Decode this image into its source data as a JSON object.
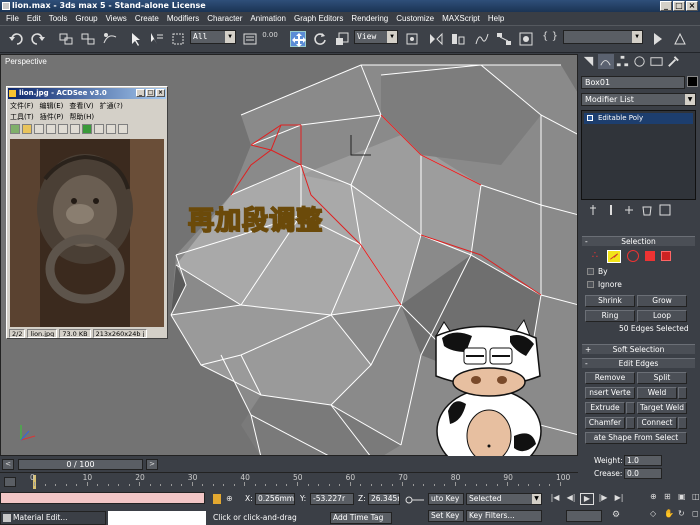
{
  "window": {
    "title": "lion.max - 3ds max 5 - Stand-alone License",
    "min": "_",
    "max": "□",
    "close": "×"
  },
  "menu": [
    "File",
    "Edit",
    "Tools",
    "Group",
    "Views",
    "Create",
    "Modifiers",
    "Character",
    "Animation",
    "Graph Editors",
    "Rendering",
    "Customize",
    "MAXScript",
    "Help"
  ],
  "toolbar": {
    "selection_filter": "All",
    "coord_system": "View",
    "angle_snap_label": "0.00"
  },
  "viewport": {
    "label": "Perspective",
    "caption": "再加段调整"
  },
  "acdsee": {
    "title": "lion.jpg - ACDSee v3.0",
    "menu_row1": [
      "文件(F)",
      "编辑(E)",
      "查看(V)",
      "扩通(?)"
    ],
    "menu_row2": [
      "工具(T)",
      "插件(P)",
      "帮助(H)"
    ],
    "status": {
      "index": "2/2",
      "file": "lion.jpg",
      "size": "73.0 KB",
      "dims": "213x260x24b j"
    }
  },
  "command_panel": {
    "object_name": "Box01",
    "modifier_list": "Modifier List",
    "stack": [
      "Editable Poly"
    ],
    "selection": {
      "title": "Selection",
      "by_label": "By",
      "ignore_label": "Ignore",
      "shrink": "Shrink",
      "grow": "Grow",
      "ring": "Ring",
      "loop": "Loop",
      "status": "50 Edges Selected"
    },
    "soft_selection": {
      "title": "Soft Selection",
      "sign": "+"
    },
    "edit_edges": {
      "title": "Edit Edges",
      "remove": "Remove",
      "split": "Split",
      "insert_vertex": "nsert Verte",
      "weld": "Weld",
      "extrude": "Extrude",
      "target_weld": "Target Weld",
      "chamfer": "Chamfer",
      "connect": "Connect",
      "create_shape": "ate Shape From Select",
      "weight_label": "Weight:",
      "weight_value": "1.0",
      "crease_label": "Crease:",
      "crease_value": "0.0"
    }
  },
  "timeline": {
    "slider": "0 / 100",
    "ticks": [
      "0",
      "10",
      "20",
      "30",
      "40",
      "50",
      "60",
      "70",
      "80",
      "90",
      "100"
    ]
  },
  "statusbar": {
    "material_editor": "Material Edit...",
    "x_label": "X:",
    "x_value": "0.256mm",
    "y_label": "Y:",
    "y_value": "-53.227r",
    "z_label": "Z:",
    "z_value": "26.345r",
    "prompt": "Click or click-and-drag",
    "add_time_tag": "Add Time Tag",
    "auto_key": "uto Key",
    "selected": "Selected",
    "set_key": "Set Key",
    "key_filters": "Key Filters..."
  }
}
